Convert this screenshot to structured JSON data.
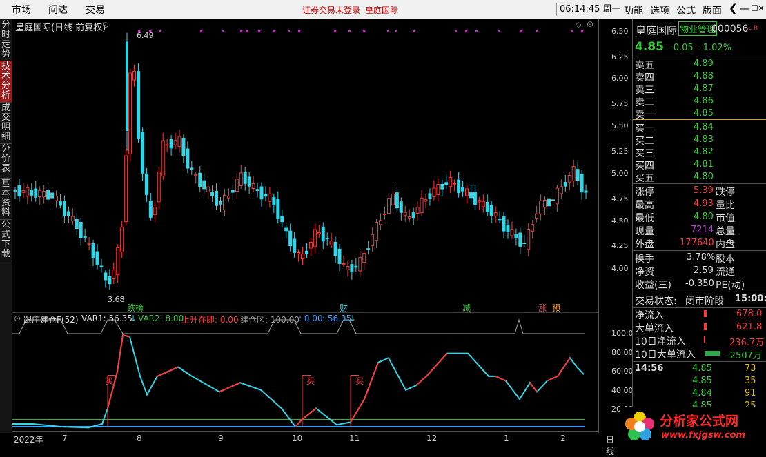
{
  "menubar": {
    "items": [
      "市场",
      "问达",
      "交易"
    ],
    "warning": "证券交易未登录",
    "warning_name": "皇庭国际",
    "clock": "06:14:45 周一",
    "right_items": [
      "功能",
      "选项",
      "公式",
      "版面"
    ],
    "ctl_back": "❮",
    "ctl_min": "—",
    "ctl_max": "☐",
    "ctl_close": "✕"
  },
  "left_tabs": [
    "分时走势",
    "技术分析",
    "成交明细",
    "分价表",
    "基本资料",
    "公式下载"
  ],
  "chart_header": {
    "title": "皇庭国际(日线 前复权)",
    "high_label": "6.49",
    "low_label": "3.68",
    "events": [
      "跌榜",
      "财",
      "减",
      "涨",
      "预"
    ]
  },
  "indicator": {
    "name": "跟庄建仓F(52)",
    "var1": "VAR1: 56.35",
    "var2": "VAR2: 8.00",
    "up": "上升在即: 0.00",
    "zone": "建仓区: 100.00",
    "v1": ": 0.00",
    "v2": ": 56.35",
    "buy_label": "买"
  },
  "price_axis": [
    "6.50",
    "6.25",
    "6.00",
    "5.75",
    "5.50",
    "5.25",
    "5.00",
    "4.75",
    "4.50",
    "4.25",
    "4.00"
  ],
  "ind_axis": [
    "100.0",
    "80.00",
    "60.00",
    "40.00",
    "20.00"
  ],
  "x_axis": [
    "2022年",
    "7",
    "8",
    "9",
    "10",
    "11",
    "12",
    "1",
    "2"
  ],
  "x_axis_mode": "日线",
  "quote": {
    "name": "皇庭国际",
    "industry": "物业管理",
    "code": "000056",
    "flags": "L R",
    "price": "4.85",
    "change": "-0.05",
    "change_pct": "-1.02%",
    "asks": [
      {
        "label": "卖五",
        "price": "4.89"
      },
      {
        "label": "卖四",
        "price": "4.88"
      },
      {
        "label": "卖三",
        "price": "4.87"
      },
      {
        "label": "卖二",
        "price": "4.86"
      },
      {
        "label": "卖一",
        "price": "4.85"
      }
    ],
    "bids": [
      {
        "label": "买一",
        "price": "4.84"
      },
      {
        "label": "买二",
        "price": "4.83"
      },
      {
        "label": "买三",
        "price": "4.82"
      },
      {
        "label": "买四",
        "price": "4.81"
      },
      {
        "label": "买五",
        "price": "4.80"
      }
    ],
    "stats": [
      {
        "l1": "涨停",
        "v1": "5.39",
        "l2": "跌停"
      },
      {
        "l1": "最高",
        "v1": "4.93",
        "l2": "量比"
      },
      {
        "l1": "最低",
        "v1": "4.80",
        "l2": "市值"
      },
      {
        "l1": "现量",
        "v1": "7214",
        "l2": "总量"
      },
      {
        "l1": "外盘",
        "v1": "177640",
        "l2": "内盘"
      }
    ],
    "stats2": [
      {
        "l1": "换手",
        "v1": "3.78%",
        "l2": "股本"
      },
      {
        "l1": "净资",
        "v1": "2.59",
        "l2": "流通"
      },
      {
        "l1": "收益(三)",
        "v1": "-0.350",
        "l2": "PE(动)"
      }
    ],
    "status_label": "交易状态:",
    "status_value": "闭市阶段",
    "status_time": "15:00:0",
    "flows": [
      {
        "label": "净流入",
        "value": "678.0"
      },
      {
        "label": "大单流入",
        "value": "621.8"
      },
      {
        "label": "10日净流入",
        "value": "236.7万"
      },
      {
        "label": "10日大单流入",
        "value": "-2507万"
      }
    ],
    "ticks": [
      {
        "time": "14:56",
        "price": "4.85",
        "vol": "73"
      },
      {
        "time": "",
        "price": "4.85",
        "vol": "35"
      },
      {
        "time": "",
        "price": "4.84",
        "vol": "91"
      },
      {
        "time": "",
        "price": "4.85",
        "vol": "25"
      }
    ]
  },
  "watermark": {
    "cn": "分析家公式网",
    "url": "www.fxjgsw.com"
  },
  "colors": {
    "up": "#ff3838",
    "down": "#33d6e6",
    "green": "#3bc93b",
    "magenta": "#e020e0"
  }
}
